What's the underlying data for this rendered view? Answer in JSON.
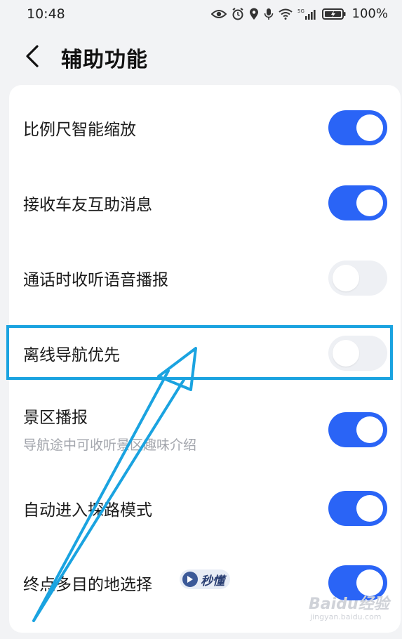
{
  "status_bar": {
    "time": "10:48",
    "network_label": "5G",
    "battery": "100%"
  },
  "header": {
    "title": "辅助功能"
  },
  "settings": [
    {
      "label": "比例尺智能缩放",
      "enabled": true
    },
    {
      "label": "接收车友互助消息",
      "enabled": true
    },
    {
      "label": "通话时收听语音播报",
      "enabled": false
    },
    {
      "label": "离线导航优先",
      "enabled": false
    },
    {
      "label": "景区播报",
      "sublabel": "导航途中可收听景区趣味介绍",
      "enabled": true
    },
    {
      "label": "自动进入探路模式",
      "enabled": true
    },
    {
      "label": "终点多目的地选择",
      "badge": "秒懂",
      "enabled": true
    }
  ],
  "watermark": {
    "main": "Baidu经验",
    "url": "jingyan.baidu.com"
  },
  "colors": {
    "toggle_on": "#2a64f6",
    "toggle_off": "#eef0f4",
    "highlight": "#1aa3e0",
    "background": "#f2f3f5"
  }
}
